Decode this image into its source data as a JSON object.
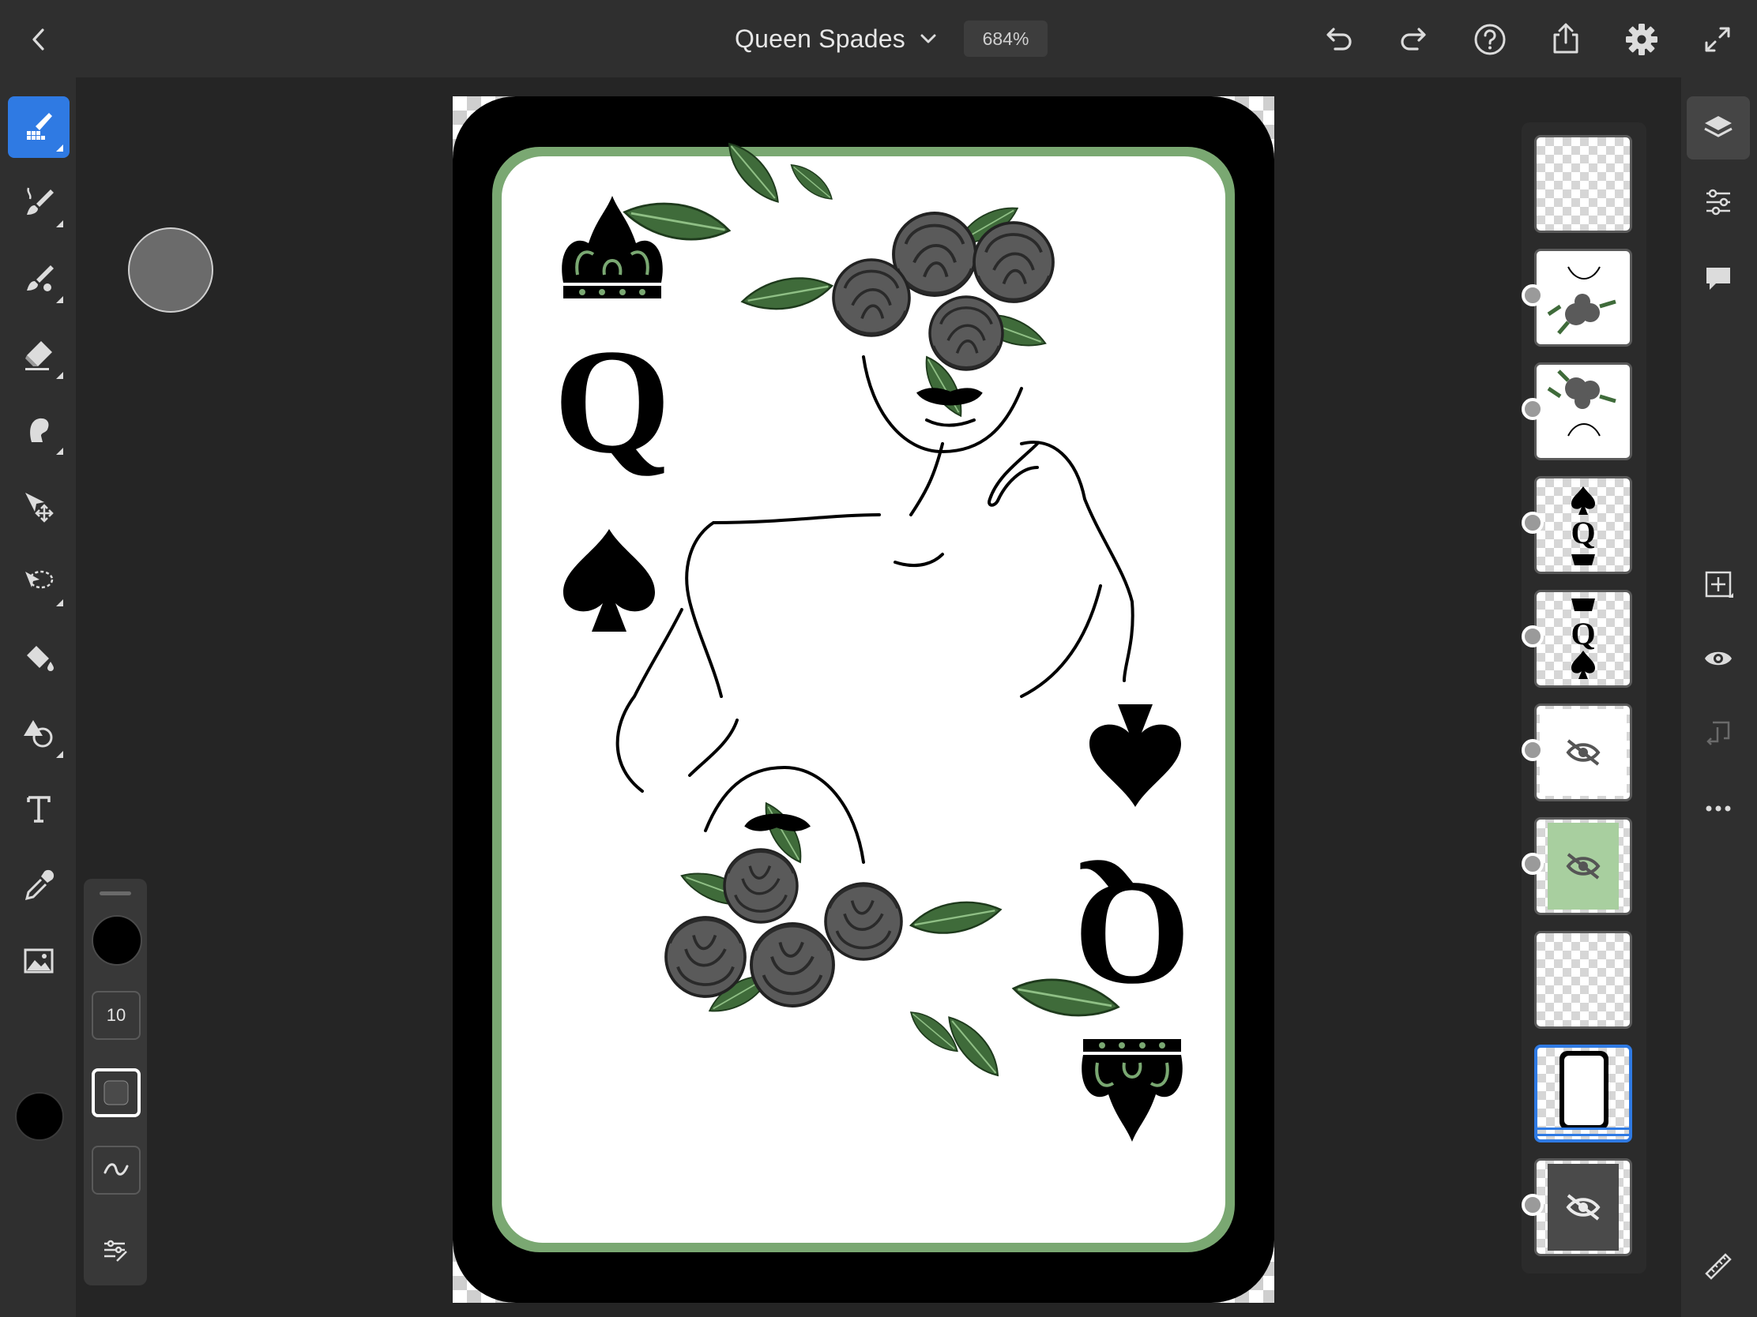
{
  "document": {
    "title": "Queen Spades",
    "zoom": "684%"
  },
  "topbar_icons": [
    "back-chevron-icon",
    "undo-icon",
    "redo-icon",
    "help-icon",
    "share-icon",
    "settings-gear-icon",
    "fullscreen-icon"
  ],
  "left_tools": [
    "pixel-brush-tool",
    "paint-brush-tool",
    "mixer-brush-tool",
    "eraser-tool",
    "smudge-tool",
    "transform-tool",
    "lasso-selection-tool",
    "fill-tool",
    "shapes-tool",
    "text-tool",
    "eyedropper-tool",
    "image-tool"
  ],
  "active_tool": "pixel-brush-tool",
  "current_color": "#000000",
  "touch_modifier": {
    "brush_size": "10",
    "color": "#000000"
  },
  "layers": [
    {
      "name": "empty-layer",
      "visible": true
    },
    {
      "name": "queen-flowers-top-layer",
      "visible": true
    },
    {
      "name": "queen-flowers-bottom-layer",
      "visible": true
    },
    {
      "name": "bottom-index-layer",
      "visible": true
    },
    {
      "name": "top-index-layer",
      "visible": true
    },
    {
      "name": "white-card-layer",
      "visible": false
    },
    {
      "name": "green-border-layer",
      "visible": false
    },
    {
      "name": "empty-layer-2",
      "visible": true
    },
    {
      "name": "card-outline-layer",
      "visible": true,
      "active": true
    },
    {
      "name": "dark-background-layer",
      "visible": false
    }
  ],
  "colors": {
    "accent": "#2f7ae3",
    "card_green": "#7aa872",
    "leaf_green": "#3f6b3a",
    "rose_gray": "#5a5a5a"
  }
}
